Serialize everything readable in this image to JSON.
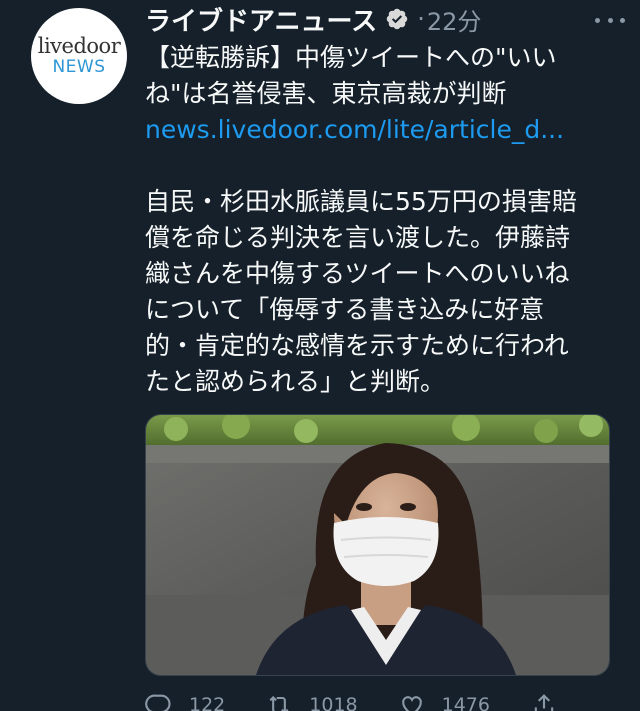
{
  "avatar": {
    "brand_top": "livedoor",
    "brand_bottom": "NEWS"
  },
  "header": {
    "display_name": "ライブドアニュース",
    "separator": "·",
    "time": "22分"
  },
  "body": {
    "line1": "【逆転勝訴】中傷ツイートへの\"いい",
    "line2": "ね\"は名誉侵害、東京高裁が判断",
    "link": "news.livedoor.com/lite/article_d...",
    "para1": "自民・杉田水脈議員に55万円の損害賠",
    "para2": "償を命じる判決を言い渡した。伊藤詩",
    "para3": "織さんを中傷するツイートへのいいね",
    "para4": "について「侮辱する書き込みに好意",
    "para5": "的・肯定的な感情を示すために行われ",
    "para6": "たと認められる」と判断。"
  },
  "actions": {
    "reply_count": "122",
    "retweet_count": "1018",
    "like_count": "1476"
  },
  "colors": {
    "background": "#15202b",
    "link": "#1d9bf0",
    "muted": "#8b98a5"
  }
}
